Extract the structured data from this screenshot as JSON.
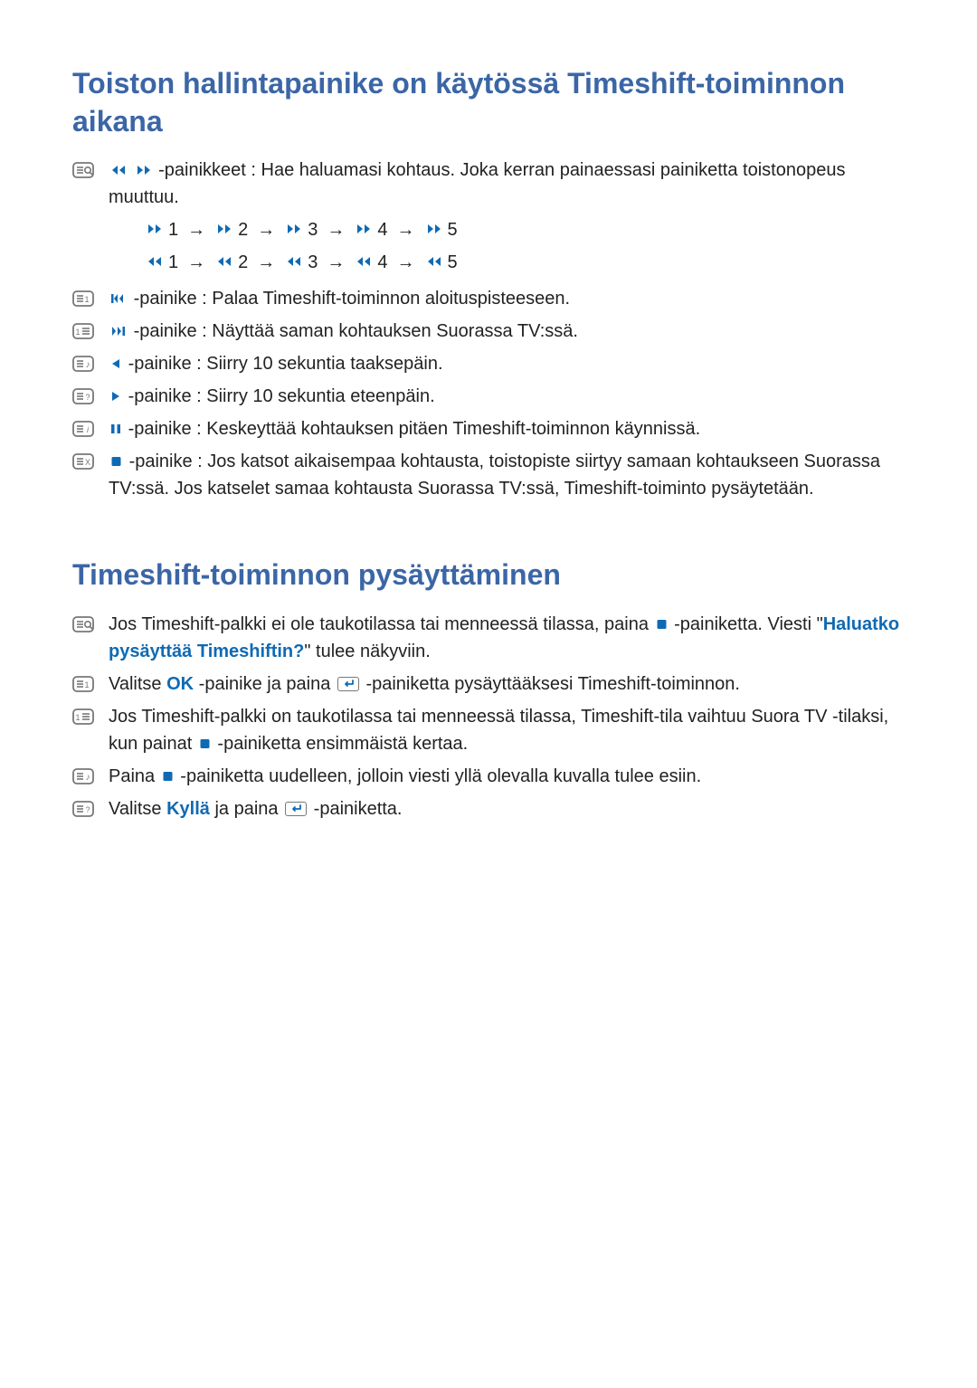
{
  "section1": {
    "title": "Toiston hallintapainike on käytössä Timeshift-toiminnon aikana",
    "item0": {
      "text_a": " -painikkeet : Hae haluamasi kohtaus. Joka kerran painaessasi painiketta toistonopeus muuttuu."
    },
    "speed_ff": {
      "n1": "1",
      "n2": "2",
      "n3": "3",
      "n4": "4",
      "n5": "5"
    },
    "speed_rw": {
      "n1": "1",
      "n2": "2",
      "n3": "3",
      "n4": "4",
      "n5": "5"
    },
    "item1": {
      "text": " -painike : Palaa Timeshift-toiminnon aloituspisteeseen."
    },
    "item2": {
      "text": " -painike : Näyttää saman kohtauksen Suorassa TV:ssä."
    },
    "item3": {
      "text": " -painike : Siirry 10 sekuntia taaksepäin."
    },
    "item4": {
      "text": " -painike : Siirry 10 sekuntia eteenpäin."
    },
    "item5": {
      "text": " -painike : Keskeyttää kohtauksen pitäen Timeshift-toiminnon käynnissä."
    },
    "item6": {
      "text": " -painike : Jos katsot aikaisempaa kohtausta, toistopiste siirtyy samaan kohtaukseen Suorassa TV:ssä. Jos katselet samaa kohtausta Suorassa TV:ssä, Timeshift-toiminto pysäytetään."
    }
  },
  "section2": {
    "title": "Timeshift-toiminnon pysäyttäminen",
    "item0": {
      "pre": "Jos Timeshift-palkki ei ole taukotilassa tai menneessä tilassa, paina ",
      "post": " -painiketta. Viesti \"",
      "highlight": "Haluatko pysäyttää Timeshiftin?",
      "tail": "\" tulee näkyviin."
    },
    "item1": {
      "pre": "Valitse ",
      "ok": "OK",
      "mid": " -painike ja paina ",
      "post": " -painiketta pysäyttääksesi Timeshift-toiminnon."
    },
    "item2": {
      "pre": "Jos Timeshift-palkki on taukotilassa tai menneessä tilassa, Timeshift-tila vaihtuu Suora TV -tilaksi, kun painat ",
      "post": " -painiketta ensimmäistä kertaa."
    },
    "item3": {
      "pre": "Paina ",
      "post": " -painiketta uudelleen, jolloin viesti yllä olevalla kuvalla tulee esiin."
    },
    "item4": {
      "pre": "Valitse ",
      "yes": "Kyllä",
      "mid": " ja paina ",
      "post": " -painiketta."
    }
  }
}
